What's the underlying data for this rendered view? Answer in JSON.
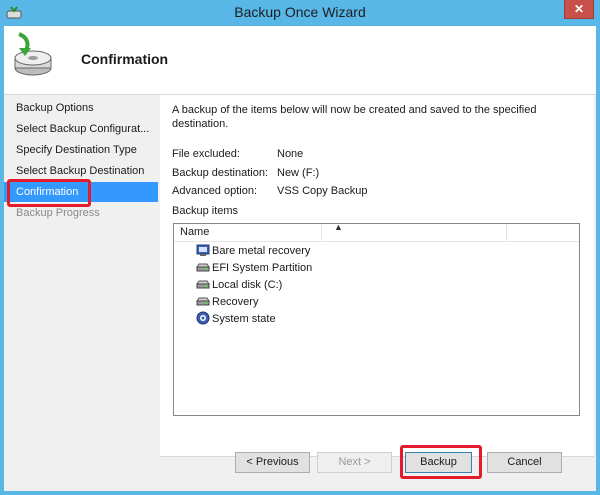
{
  "window": {
    "title": "Backup Once Wizard",
    "close_glyph": "✕"
  },
  "header": {
    "title": "Confirmation",
    "icon": "backup-disk-icon"
  },
  "sidebar": {
    "items": [
      {
        "label": "Backup Options"
      },
      {
        "label": "Select Backup Configurat..."
      },
      {
        "label": "Specify Destination Type"
      },
      {
        "label": "Select Backup Destination"
      },
      {
        "label": "Confirmation"
      },
      {
        "label": "Backup Progress"
      }
    ]
  },
  "content": {
    "description": "A backup of the items below will now be created and saved to the specified destination.",
    "details": [
      {
        "label": "File excluded:",
        "value": "None"
      },
      {
        "label": "Backup destination:",
        "value": "New (F:)"
      },
      {
        "label": "Advanced option:",
        "value": "VSS Copy Backup"
      }
    ],
    "items_label": "Backup items",
    "list": {
      "column_header": "Name",
      "sort_glyph": "▲",
      "rows": [
        {
          "label": "Bare metal recovery",
          "icon": "bare-metal-icon"
        },
        {
          "label": "EFI System Partition",
          "icon": "drive-icon"
        },
        {
          "label": "Local disk (C:)",
          "icon": "drive-icon"
        },
        {
          "label": "Recovery",
          "icon": "drive-icon"
        },
        {
          "label": "System state",
          "icon": "system-state-icon"
        }
      ]
    }
  },
  "footer": {
    "previous": "< Previous",
    "next": "Next >",
    "backup": "Backup",
    "cancel": "Cancel"
  },
  "colors": {
    "accent": "#3399ff",
    "highlight_box": "#e41b2b",
    "titlebar": "#58b7e6"
  }
}
